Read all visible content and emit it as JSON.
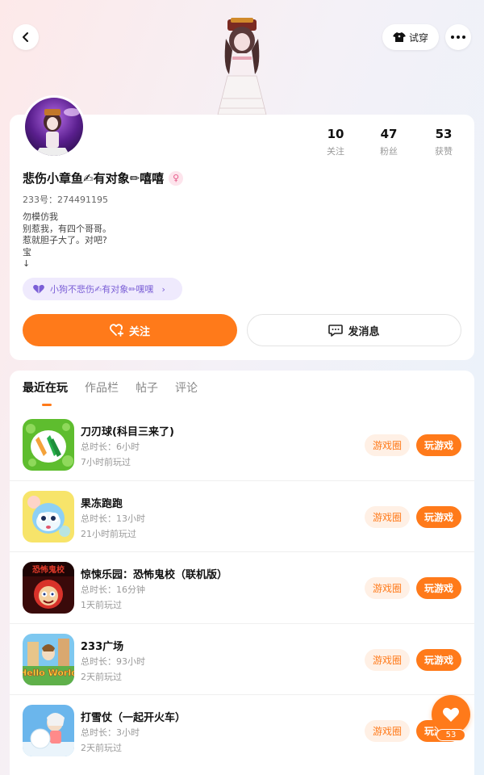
{
  "header": {
    "tryon_label": "试穿"
  },
  "profile": {
    "nickname": "悲伤小章鱼✍有对象✏嘻嘻",
    "uid": "233号：274491195",
    "bio_lines": [
      "勿模仿我",
      "别惹我，有四个哥哥。",
      "惹就胆子大了。对吧?",
      "宝",
      "↓"
    ],
    "stats": [
      {
        "value": "10",
        "label": "关注"
      },
      {
        "value": "47",
        "label": "粉丝"
      },
      {
        "value": "53",
        "label": "获赞"
      }
    ],
    "tag_text": "小狗不悲伤✍有对象✏嘿嘿",
    "follow_label": "关注",
    "message_label": "发消息"
  },
  "tabs": [
    {
      "label": "最近在玩",
      "active": true
    },
    {
      "label": "作品栏",
      "active": false
    },
    {
      "label": "帖子",
      "active": false
    },
    {
      "label": "评论",
      "active": false
    }
  ],
  "games": [
    {
      "name": "刀刃球(科目三来了)",
      "duration": "总时长：6小时",
      "last_played": "7小时前玩过",
      "circle_label": "游戏圈",
      "play_label": "玩游戏"
    },
    {
      "name": "果冻跑跑",
      "duration": "总时长：13小时",
      "last_played": "21小时前玩过",
      "circle_label": "游戏圈",
      "play_label": "玩游戏"
    },
    {
      "name": "惊悚乐园：恐怖鬼校（联机版）",
      "duration": "总时长：16分钟",
      "last_played": "1天前玩过",
      "circle_label": "游戏圈",
      "play_label": "玩游戏"
    },
    {
      "name": "233广场",
      "duration": "总时长：93小时",
      "last_played": "2天前玩过",
      "circle_label": "游戏圈",
      "play_label": "玩游戏"
    },
    {
      "name": "打雪仗（一起开火车）",
      "duration": "总时长：3小时",
      "last_played": "2天前玩过",
      "circle_label": "游戏圈",
      "play_label": "玩游戏"
    }
  ],
  "game_icon_text": {
    "horror_title": "恐怖鬼校",
    "hello_world": "Hello World"
  },
  "like_fab": {
    "count": "53"
  },
  "colors": {
    "accent": "#ff7a1a",
    "tag_purple": "#7b5fd6"
  }
}
